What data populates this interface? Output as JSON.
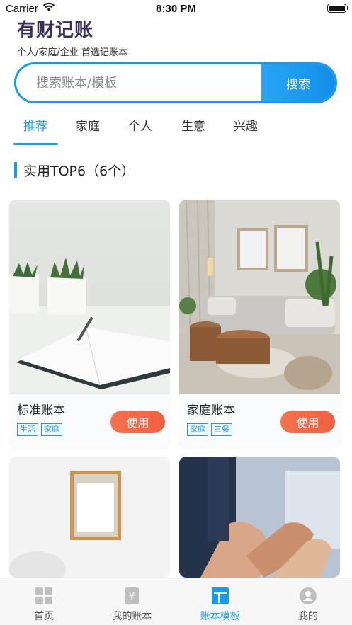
{
  "status_bar": {
    "carrier": "Carrier",
    "time": "8:30 PM"
  },
  "header": {
    "title": "有财记账",
    "subtitle": "个人/家庭/企业 首选记账本"
  },
  "search": {
    "placeholder": "搜索账本/模板",
    "button_label": "搜索"
  },
  "tabs": [
    {
      "label": "推荐",
      "active": true
    },
    {
      "label": "家庭",
      "active": false
    },
    {
      "label": "个人",
      "active": false
    },
    {
      "label": "生意",
      "active": false
    },
    {
      "label": "兴趣",
      "active": false
    }
  ],
  "section": {
    "title": "实用TOP6（6个）"
  },
  "cards": [
    {
      "name": "标准账本",
      "tags": [
        "生活",
        "家庭"
      ],
      "button_label": "使用"
    },
    {
      "name": "家庭账本",
      "tags": [
        "家庭",
        "三餐"
      ],
      "button_label": "使用"
    }
  ],
  "tab_bar": [
    {
      "label": "首页",
      "icon": "grid-icon",
      "active": false
    },
    {
      "label": "我的账本",
      "icon": "ledger-icon",
      "active": false
    },
    {
      "label": "账本模板",
      "icon": "template-icon",
      "active": true
    },
    {
      "label": "我的",
      "icon": "user-icon",
      "active": false
    }
  ],
  "colors": {
    "accent": "#1a98ec",
    "use_button": "#f4684a",
    "title": "#3b2f5a"
  }
}
